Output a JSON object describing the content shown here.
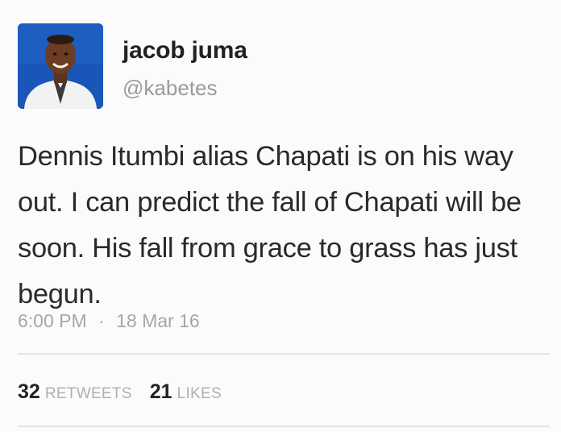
{
  "author": {
    "name": "jacob juma",
    "handle": "@kabetes"
  },
  "tweet": {
    "text": "Dennis Itumbi alias Chapati is on his way out. I can predict the fall of Chapati will be soon. His fall from grace to grass has just begun.",
    "time": "6:00 PM",
    "separator": "·",
    "date": "18 Mar 16"
  },
  "stats": {
    "retweets_count": "32",
    "retweets_label": "RETWEETS",
    "likes_count": "21",
    "likes_label": "LIKES"
  },
  "colors": {
    "avatar_bg": "#1a56b8",
    "muted_text": "#9b9b9b",
    "body_text": "#2a2a2a"
  }
}
